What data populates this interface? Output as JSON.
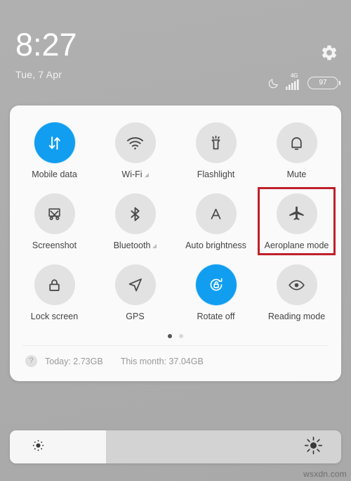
{
  "status": {
    "time": "8:27",
    "date": "Tue, 7 Apr",
    "settings_icon": "gear-icon",
    "dnd_icon": "moon-icon",
    "network_type": "4G",
    "signal_icon": "signal-bars-icon",
    "battery_level": "97"
  },
  "panel": {
    "tiles": [
      {
        "label": "Mobile data",
        "icon": "mobile-data-icon",
        "active": true,
        "expandable": false,
        "highlighted": false
      },
      {
        "label": "Wi-Fi",
        "icon": "wifi-icon",
        "active": false,
        "expandable": true,
        "highlighted": false
      },
      {
        "label": "Flashlight",
        "icon": "flashlight-icon",
        "active": false,
        "expandable": false,
        "highlighted": false
      },
      {
        "label": "Mute",
        "icon": "bell-icon",
        "active": false,
        "expandable": false,
        "highlighted": false
      },
      {
        "label": "Screenshot",
        "icon": "screenshot-icon",
        "active": false,
        "expandable": false,
        "highlighted": false
      },
      {
        "label": "Bluetooth",
        "icon": "bluetooth-icon",
        "active": false,
        "expandable": true,
        "highlighted": false
      },
      {
        "label": "Auto brightness",
        "icon": "auto-brightness-icon",
        "active": false,
        "expandable": false,
        "highlighted": false
      },
      {
        "label": "Aeroplane mode",
        "icon": "aeroplane-icon",
        "active": false,
        "expandable": false,
        "highlighted": true
      },
      {
        "label": "Lock screen",
        "icon": "padlock-icon",
        "active": false,
        "expandable": false,
        "highlighted": false
      },
      {
        "label": "GPS",
        "icon": "location-arrow-icon",
        "active": false,
        "expandable": false,
        "highlighted": false
      },
      {
        "label": "Rotate off",
        "icon": "rotation-lock-icon",
        "active": true,
        "expandable": false,
        "highlighted": false
      },
      {
        "label": "Reading mode",
        "icon": "eye-icon",
        "active": false,
        "expandable": false,
        "highlighted": false
      }
    ],
    "pager": {
      "pages": 2,
      "active_page": 1
    },
    "data_usage": {
      "help_icon": "question-mark-icon",
      "today": "Today: 2.73GB",
      "this_month": "This month: 37.04GB"
    }
  },
  "brightness": {
    "low_icon": "brightness-low-icon",
    "high_icon": "brightness-high-icon",
    "level_percent": 29
  },
  "watermark": "wsxdn.com",
  "colors": {
    "accent": "#119ef0",
    "highlight": "#c0202a",
    "panel_bg": "#fafafa",
    "tile_bg": "#e2e2e2",
    "wallpaper": "#adadad"
  }
}
